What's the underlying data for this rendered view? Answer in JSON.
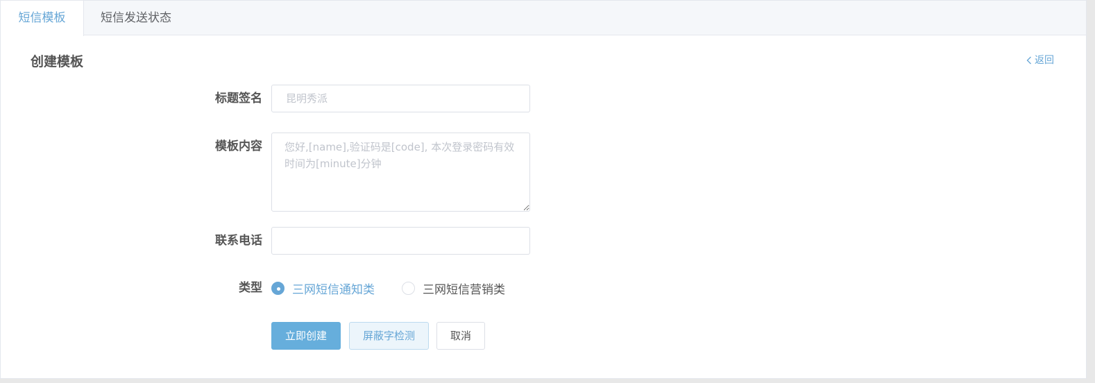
{
  "tabs": [
    {
      "label": "短信模板",
      "active": true
    },
    {
      "label": "短信发送状态",
      "active": false
    }
  ],
  "page": {
    "title": "创建模板",
    "back_label": "返回"
  },
  "form": {
    "title_label": "标题签名",
    "title_placeholder": "昆明秀派",
    "content_label": "模板内容",
    "content_placeholder": "您好,[name],验证码是[code], 本次登录密码有效时间为[minute]分钟",
    "phone_label": "联系电话",
    "phone_value": "",
    "type_label": "类型",
    "type_options": [
      {
        "label": "三网短信通知类",
        "selected": true
      },
      {
        "label": "三网短信营销类",
        "selected": false
      }
    ]
  },
  "buttons": {
    "create": "立即创建",
    "check": "屏蔽字检测",
    "cancel": "取消"
  },
  "colors": {
    "accent": "#66a6d6",
    "primary_button": "#66aedc",
    "text": "#555555"
  }
}
